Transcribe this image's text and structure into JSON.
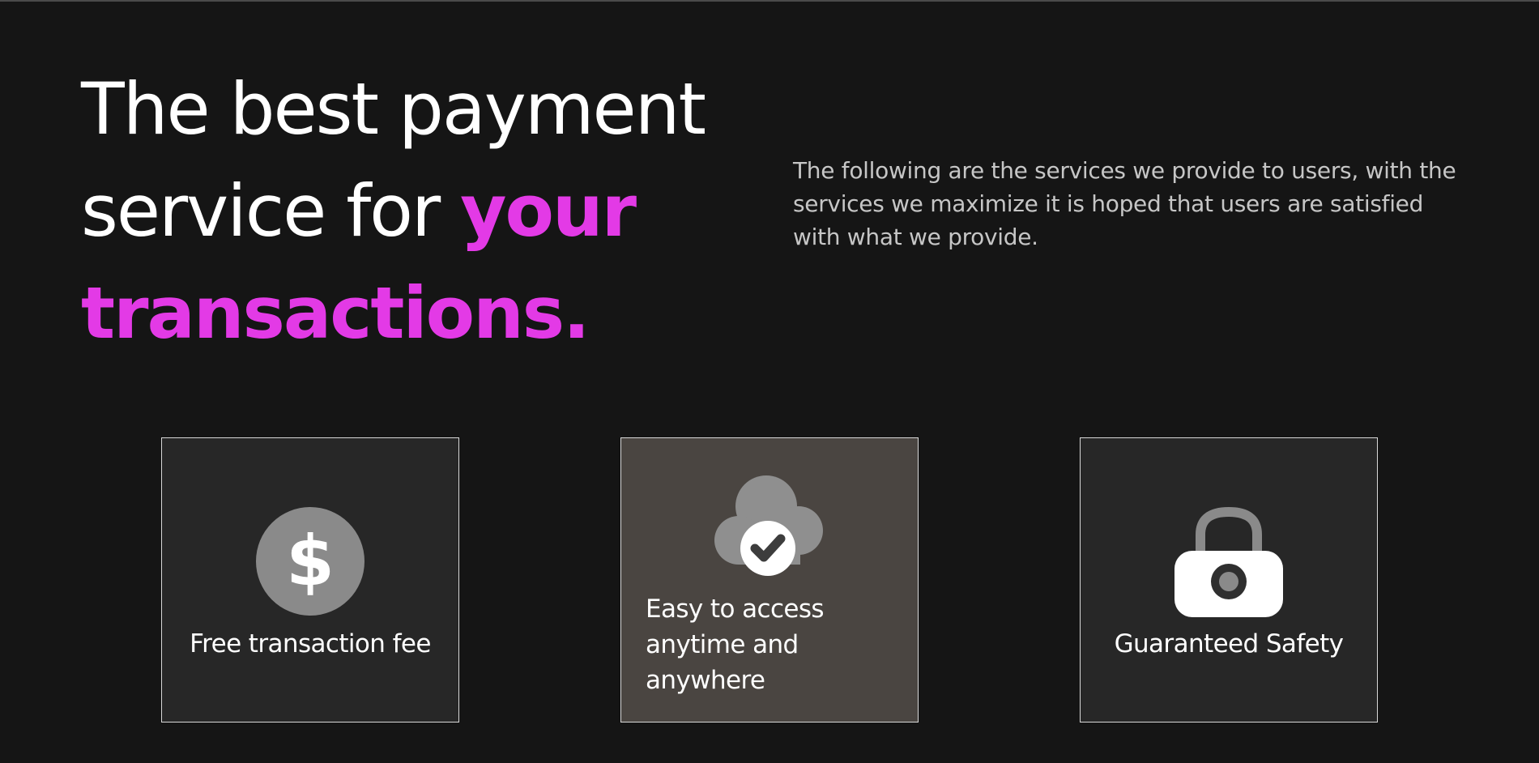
{
  "hero": {
    "headline_plain": "The best payment service for ",
    "headline_accent": "your transactions.",
    "description": "The following are the services we provide to users, with the services we maximize it is hoped that users are satisfied with what we provide."
  },
  "features": [
    {
      "label": "Free transaction fee",
      "icon": "dollar-icon"
    },
    {
      "label": "Easy to access anytime and anywhere",
      "icon": "cloud-check-icon"
    },
    {
      "label": "Guaranteed Safety",
      "icon": "lock-icon"
    }
  ],
  "colors": {
    "background": "#151515",
    "accent": "#e33ae6",
    "card": "#272727",
    "card_active": "#4a4541",
    "card_border": "#d8d8d8"
  }
}
